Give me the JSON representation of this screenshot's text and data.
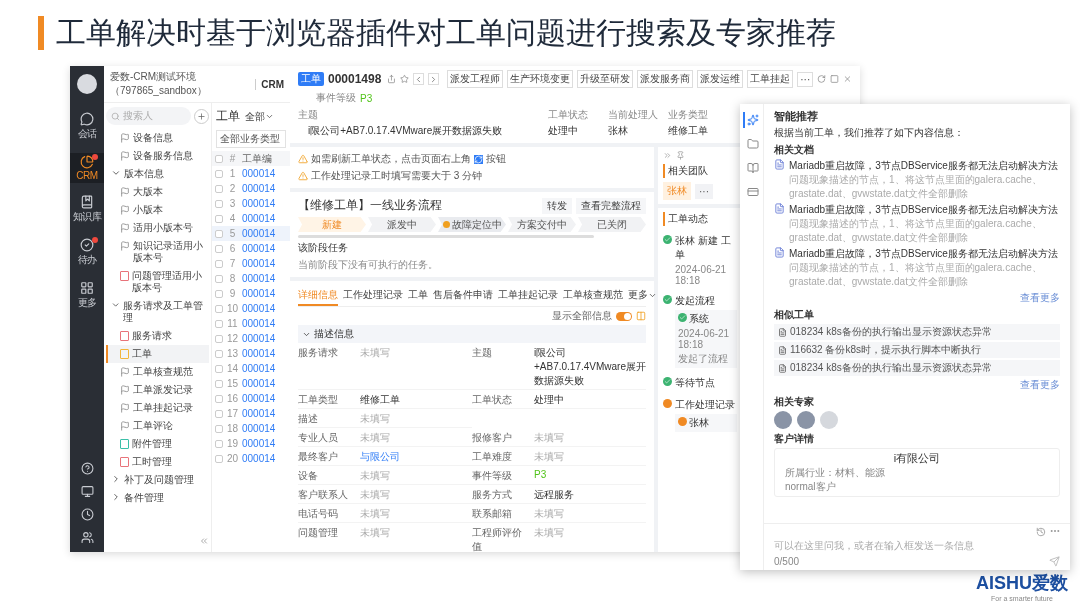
{
  "slide": {
    "title": "工单解决时基于浏览器插件对工单问题进行搜索及专家推荐",
    "logo": "AISHU爱数",
    "tagline": "For a smarter future"
  },
  "rail": {
    "items": [
      {
        "label": "会话",
        "selected": false,
        "badge": false,
        "kind": "chat"
      },
      {
        "label": "CRM",
        "selected": true,
        "badge": true,
        "kind": "crm"
      },
      {
        "label": "知识库",
        "selected": false,
        "badge": false,
        "kind": "book"
      },
      {
        "label": "待办",
        "selected": false,
        "badge": true,
        "kind": "todo"
      },
      {
        "label": "更多",
        "selected": false,
        "badge": false,
        "kind": "grid"
      }
    ]
  },
  "env": {
    "title": "爱数-CRM测试环境（797865_sandbox）",
    "module": "CRM"
  },
  "tree": {
    "search_placeholder": "搜索人",
    "items": [
      {
        "kind": "flag",
        "label": "设备信息",
        "selected": false
      },
      {
        "kind": "flag",
        "label": "设备服务信息",
        "selected": false
      },
      {
        "kind": "group",
        "label": "版本信息",
        "expanded": true,
        "children": [
          {
            "kind": "flag",
            "label": "大版本",
            "selected": false
          },
          {
            "kind": "flag",
            "label": "小版本",
            "selected": false
          },
          {
            "kind": "flag",
            "label": "适用小版本号",
            "selected": false
          },
          {
            "kind": "flag",
            "label": "知识记录适用小版本号",
            "selected": false
          },
          {
            "kind": "doc",
            "label": "问题管理适用小版本号",
            "color": "#e8737a",
            "selected": false
          }
        ]
      },
      {
        "kind": "group",
        "label": "服务请求及工单管理",
        "expanded": true,
        "children": [
          {
            "kind": "doc",
            "label": "服务请求",
            "color": "#e8737a",
            "selected": false
          },
          {
            "kind": "doc",
            "label": "工单",
            "color": "#f2b53a",
            "selected": true
          },
          {
            "kind": "flag",
            "label": "工单核查规范",
            "selected": false
          },
          {
            "kind": "flag",
            "label": "工单派发记录",
            "selected": false
          },
          {
            "kind": "flag",
            "label": "工单挂起记录",
            "selected": false
          },
          {
            "kind": "flag",
            "label": "工单评论",
            "selected": false
          },
          {
            "kind": "doc",
            "label": "附件管理",
            "color": "#3bbfa8",
            "selected": false
          },
          {
            "kind": "doc",
            "label": "工时管理",
            "color": "#e8737a",
            "selected": false
          }
        ]
      },
      {
        "kind": "group",
        "label": "补丁及问题管理",
        "expanded": false
      },
      {
        "kind": "group",
        "label": "备件管理",
        "expanded": false
      }
    ]
  },
  "list": {
    "title": "工单",
    "filter": "全部",
    "type_filter": "全部业务类型",
    "columns": [
      "#",
      "工单编"
    ],
    "all_checked": false,
    "rows": [
      {
        "index": "1",
        "number": "000014",
        "checked": false,
        "selected": false
      },
      {
        "index": "2",
        "number": "000014",
        "checked": false,
        "selected": false
      },
      {
        "index": "3",
        "number": "000014",
        "checked": false,
        "selected": false
      },
      {
        "index": "4",
        "number": "000014",
        "checked": false,
        "selected": false
      },
      {
        "index": "5",
        "number": "000014",
        "checked": false,
        "selected": true
      },
      {
        "index": "6",
        "number": "000014",
        "checked": false,
        "selected": false
      },
      {
        "index": "7",
        "number": "000014",
        "checked": false,
        "selected": false
      },
      {
        "index": "8",
        "number": "000014",
        "checked": false,
        "selected": false
      },
      {
        "index": "9",
        "number": "000014",
        "checked": false,
        "selected": false
      },
      {
        "index": "10",
        "number": "000014",
        "checked": false,
        "selected": false
      },
      {
        "index": "11",
        "number": "000014",
        "checked": false,
        "selected": false
      },
      {
        "index": "12",
        "number": "000014",
        "checked": false,
        "selected": false
      },
      {
        "index": "13",
        "number": "000014",
        "checked": false,
        "selected": false
      },
      {
        "index": "14",
        "number": "000014",
        "checked": false,
        "selected": false
      },
      {
        "index": "15",
        "number": "000014",
        "checked": false,
        "selected": false
      },
      {
        "index": "16",
        "number": "000014",
        "checked": false,
        "selected": false
      },
      {
        "index": "17",
        "number": "000014",
        "checked": false,
        "selected": false
      },
      {
        "index": "18",
        "number": "000014",
        "checked": false,
        "selected": false
      },
      {
        "index": "19",
        "number": "000014",
        "checked": false,
        "selected": false
      },
      {
        "index": "20",
        "number": "000014",
        "checked": false,
        "selected": false
      }
    ]
  },
  "ticket": {
    "badge": "工单",
    "number": "00001498",
    "actions": [
      "派发工程师",
      "生产环境变更",
      "升级至研发",
      "派发服务商",
      "派发运维",
      "工单挂起",
      "···"
    ],
    "level_label": "事件等级",
    "level": "P3",
    "summary": [
      {
        "label": "主题",
        "value": "i限公司+AB7.0.17.4VMware展开数据源失败"
      },
      {
        "label": "工单状态",
        "value": "处理中"
      },
      {
        "label": "当前处理人",
        "value": "张林"
      },
      {
        "label": "业务类型",
        "value": "维修工单"
      }
    ],
    "notices": [
      {
        "text": "如需刷新工单状态，点击页面右上角",
        "suffix": "按钮"
      },
      {
        "text": "工作处理记录工时填写需要大于 3 分钟"
      }
    ],
    "flow": {
      "title": "【维修工单】一线业务流程",
      "buttons": [
        "转发",
        "查看完整流程"
      ],
      "stages": [
        {
          "label": "新建",
          "done": true,
          "current": false
        },
        {
          "label": "派发中",
          "done": false,
          "current": false
        },
        {
          "label": "故障定位中",
          "done": false,
          "current": true
        },
        {
          "label": "方案交付中",
          "done": false,
          "current": false
        },
        {
          "label": "已关闭",
          "done": false,
          "current": false
        }
      ],
      "task_title": "该阶段任务",
      "task_text": "当前阶段下没有可执行的任务。"
    },
    "tabs": [
      {
        "label": "详细信息",
        "selected": true,
        "dropdown": false
      },
      {
        "label": "工作处理记录",
        "selected": false,
        "dropdown": false
      },
      {
        "label": "工单",
        "selected": false,
        "dropdown": false
      },
      {
        "label": "售后备件申请",
        "selected": false,
        "dropdown": false
      },
      {
        "label": "工单挂起记录",
        "selected": false,
        "dropdown": false
      },
      {
        "label": "工单核查规范",
        "selected": false,
        "dropdown": false
      },
      {
        "label": "更多",
        "selected": false,
        "dropdown": true
      }
    ],
    "toggle": {
      "label": "显示全部信息",
      "on": true
    },
    "section": {
      "title": "描述信息",
      "expanded": true
    },
    "fields": [
      [
        {
          "label": "服务请求",
          "value": "未填写",
          "kind": "empty"
        },
        {
          "label": "主题",
          "value": "i限公司+AB7.0.17.4VMware展开数据源失败",
          "kind": "text"
        }
      ],
      [
        {
          "label": "工单类型",
          "value": "维修工单",
          "kind": "text"
        },
        {
          "label": "工单状态",
          "value": "处理中",
          "kind": "text"
        }
      ],
      [
        {
          "label": "描述",
          "value": "未填写",
          "kind": "empty"
        }
      ],
      [
        {
          "label": "专业人员",
          "value": "未填写",
          "kind": "empty"
        },
        {
          "label": "报修客户",
          "value": "未填写",
          "kind": "empty"
        }
      ],
      [
        {
          "label": "最终客户",
          "value": "与限公司",
          "kind": "link"
        },
        {
          "label": "工单难度",
          "value": "未填写",
          "kind": "empty"
        }
      ],
      [
        {
          "label": "设备",
          "value": "未填写",
          "kind": "empty"
        },
        {
          "label": "事件等级",
          "value": "P3",
          "kind": "level"
        }
      ],
      [
        {
          "label": "客户联系人",
          "value": "未填写",
          "kind": "empty"
        },
        {
          "label": "服务方式",
          "value": "远程服务",
          "kind": "text"
        }
      ],
      [
        {
          "label": "电话号码",
          "value": "未填写",
          "kind": "empty"
        },
        {
          "label": "联系邮箱",
          "value": "未填写",
          "kind": "empty"
        }
      ],
      [
        {
          "label": "问题管理",
          "value": "未填写",
          "kind": "empty"
        },
        {
          "label": "工程师评价值",
          "value": "未填写",
          "kind": "empty"
        }
      ]
    ],
    "team": {
      "title": "相关团队",
      "members": [
        "张林"
      ],
      "more": "···"
    },
    "activity": {
      "title": "工单动态",
      "items": [
        {
          "title": "张林 新建 工单",
          "time": "2024-06-21 18:18",
          "done": true
        },
        {
          "title": "发起流程",
          "done": true,
          "detail": {
            "actor": "系统",
            "time": "2024-06-21 18:18",
            "text": "发起了流程",
            "done": true
          }
        },
        {
          "title": "等待节点",
          "done": true
        },
        {
          "title": "工作处理记录",
          "done": false,
          "detail": {
            "actor": "张林",
            "done": false
          }
        }
      ]
    }
  },
  "plugin": {
    "tools": [
      {
        "kind": "recommend",
        "selected": true
      },
      {
        "kind": "folder",
        "selected": false
      },
      {
        "kind": "notes",
        "selected": false
      },
      {
        "kind": "card",
        "selected": false
      }
    ],
    "title": "智能推荐",
    "intro": "根据当前工单，我们推荐了如下内容信息：",
    "docs_title": "相关文档",
    "docs": [
      {
        "title": "Mariadb重启故障，3节点DBService服务都无法启动解决方法",
        "snippet": "问题现象描述的节点，1、将这节点里面的galera.cache、grastate.dat、gvwstate.dat文件全部删除"
      },
      {
        "title": "Mariadb重启故障，3节点DBService服务都无法启动解决方法",
        "snippet": "问题现象描述的节点，1、将这节点里面的galera.cache、grastate.dat、gvwstate.dat文件全部删除"
      },
      {
        "title": "Mariadb重启故障，3节点DBService服务都无法启动解决方法",
        "snippet": "问题现象描述的节点，1、将这节点里面的galera.cache、grastate.dat、gvwstate.dat文件全部删除"
      }
    ],
    "docs_more": "查看更多",
    "tickets_title": "相似工单",
    "tickets": [
      "018234 k8s备份的执行输出显示资源状态异常",
      "116632 备份k8s时，提示执行脚本中断执行",
      "018234 k8s备份的执行输出显示资源状态异常"
    ],
    "tickets_more": "查看更多",
    "experts_title": "相关专家",
    "experts": [
      {
        "kind": "person"
      },
      {
        "kind": "person"
      },
      {
        "kind": "robot"
      }
    ],
    "customer_title": "客户详情",
    "customer": {
      "name": "i有限公司",
      "industry": "所属行业：材料、能源",
      "tier": "normal客户"
    },
    "input": {
      "placeholder": "可以在这里问我，或者在输入框发送一条信息",
      "counter": "0/500"
    }
  }
}
